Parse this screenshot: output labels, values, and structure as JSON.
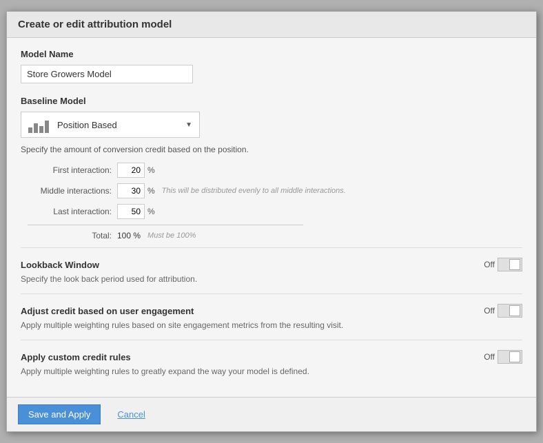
{
  "dialog": {
    "title": "Create or edit attribution model"
  },
  "model_name": {
    "label": "Model Name",
    "value": "Store Growers Model",
    "placeholder": "Model Name"
  },
  "baseline_model": {
    "label": "Baseline Model",
    "selected": "Position Based",
    "description": "Specify the amount of conversion credit based on the position."
  },
  "interactions": {
    "first_label": "First interaction:",
    "first_value": "20",
    "middle_label": "Middle interactions:",
    "middle_value": "30",
    "middle_note": "This will be distributed evenly to all middle interactions.",
    "last_label": "Last interaction:",
    "last_value": "50",
    "total_label": "Total:",
    "total_value": "100 %",
    "must_be": "Must be 100%"
  },
  "features": [
    {
      "id": "lookback-window",
      "title": "Lookback Window",
      "description": "Specify the look back period used for attribution.",
      "toggle_state": "Off"
    },
    {
      "id": "adjust-credit",
      "title": "Adjust credit based on user engagement",
      "description": "Apply multiple weighting rules based on site engagement metrics from the resulting visit.",
      "toggle_state": "Off"
    },
    {
      "id": "custom-credit",
      "title": "Apply custom credit rules",
      "description": "Apply multiple weighting rules to greatly expand the way your model is defined.",
      "toggle_state": "Off"
    }
  ],
  "footer": {
    "save_label": "Save and Apply",
    "cancel_label": "Cancel"
  }
}
